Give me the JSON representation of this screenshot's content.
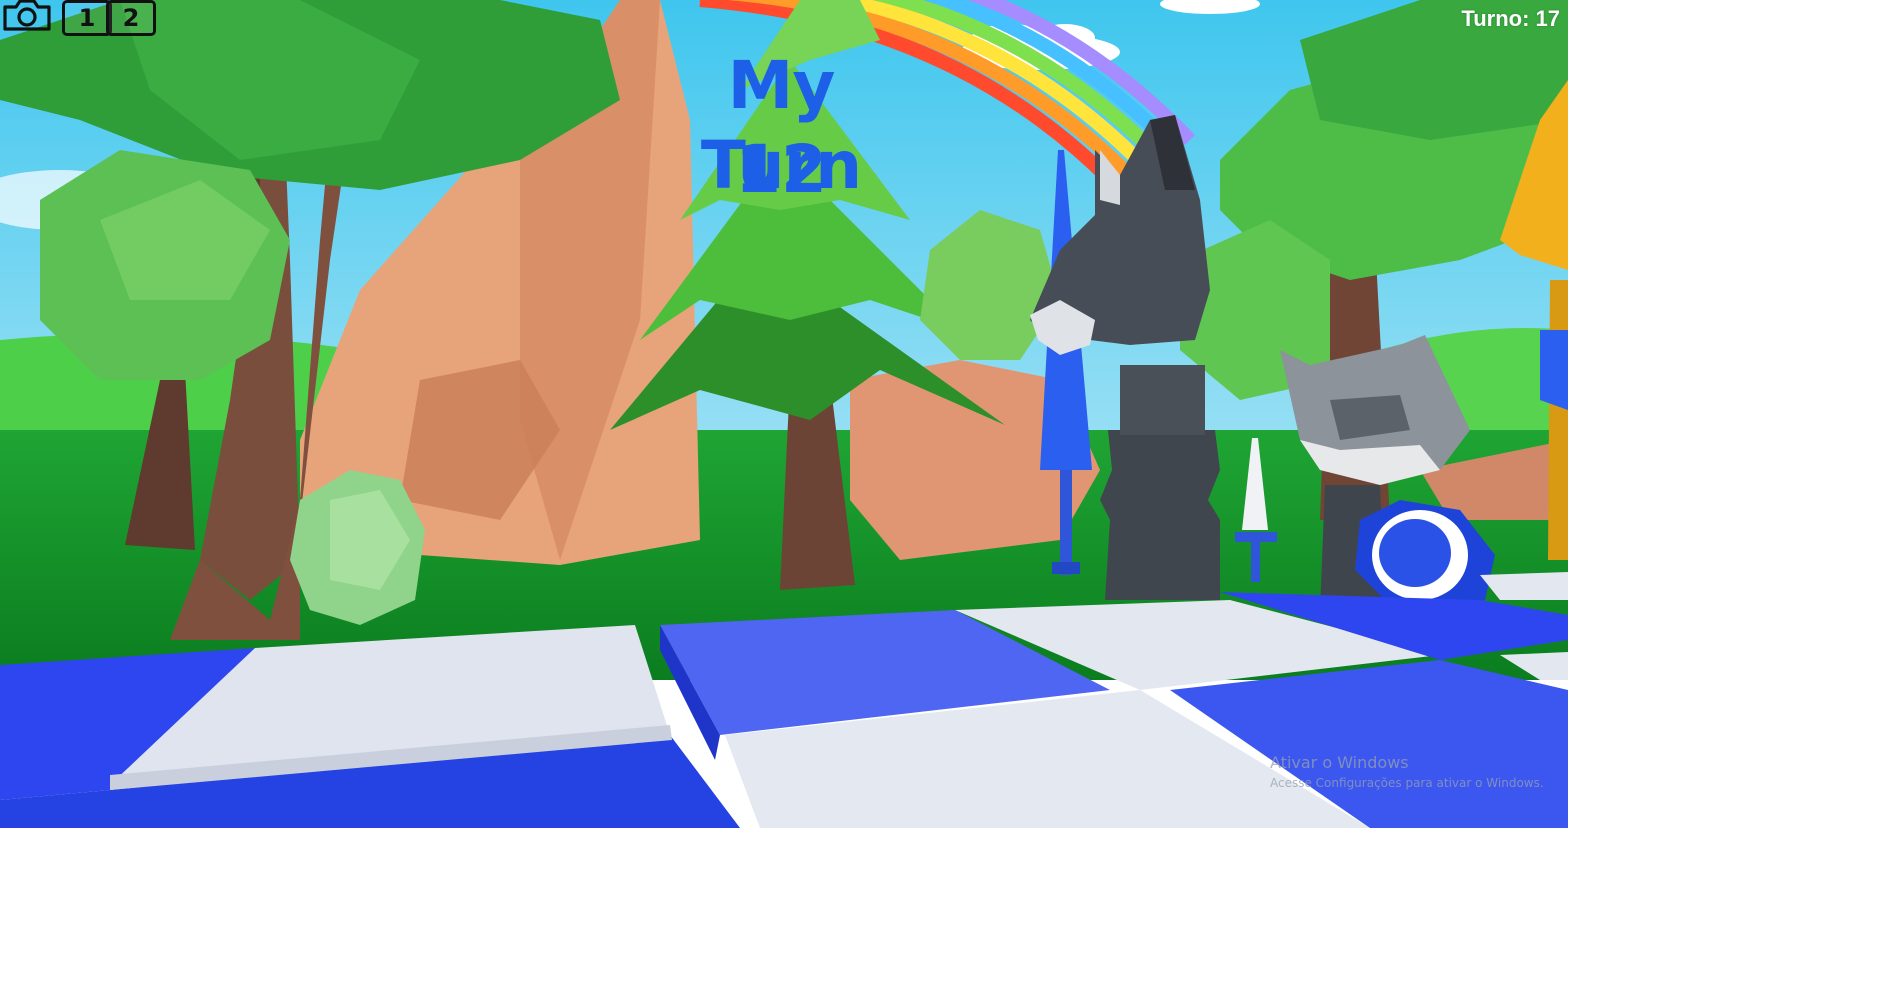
{
  "hud": {
    "camera_icon": "camera-icon",
    "camera_button_1": "1",
    "camera_button_2": "2",
    "turn_counter": "Turno: 17"
  },
  "turn_banner": {
    "title": "My Turn",
    "timer": "12",
    "color": "#1d5fe6"
  },
  "board": {
    "light_tile_color": "#dfe4ee",
    "dark_tile_color": "#2e46ef"
  },
  "pieces": [
    {
      "name": "donkey-knight-piece",
      "color": "dark-gray"
    },
    {
      "name": "raccoon-piece",
      "color": "gray"
    },
    {
      "name": "giraffe-piece",
      "color": "yellow"
    }
  ],
  "watermark": {
    "title": "Ativar o Windows",
    "subtitle": "Acesse Configurações para ativar o Windows."
  }
}
